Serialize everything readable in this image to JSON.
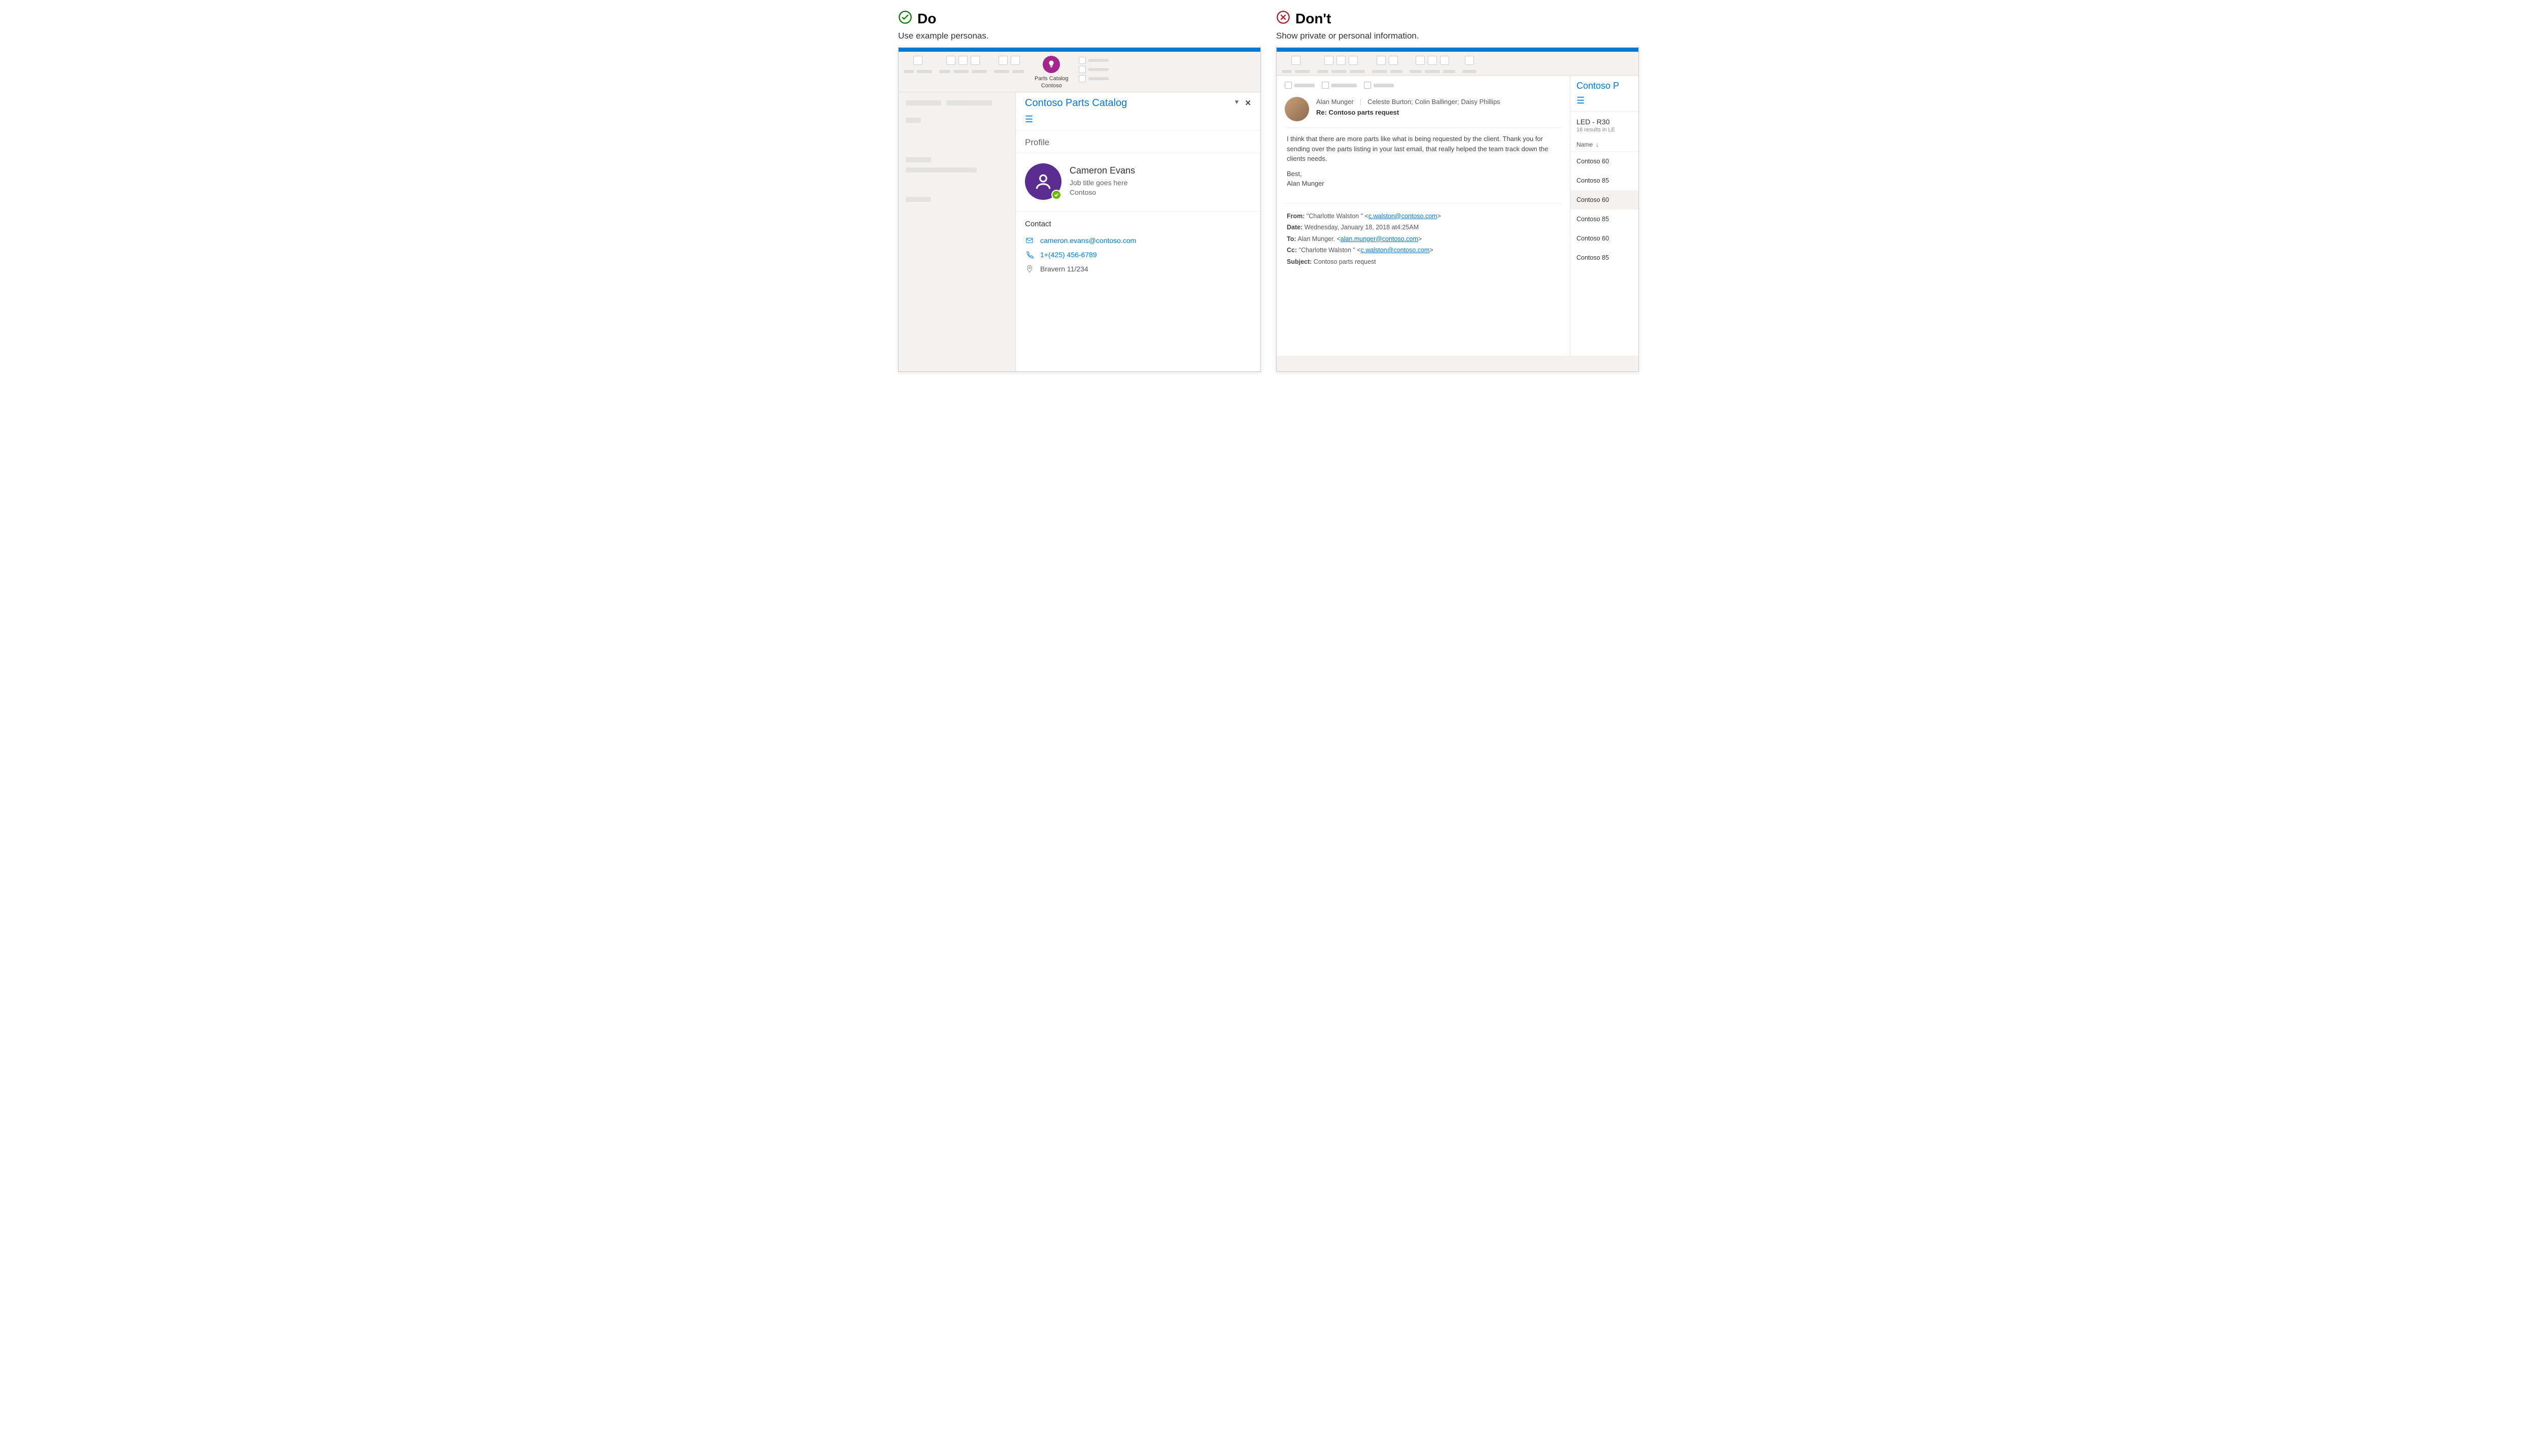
{
  "do": {
    "title": "Do",
    "subtitle": "Use example personas.",
    "addin": {
      "name": "Parts Catalog",
      "publisher": "Contoso"
    },
    "taskpane": {
      "title": "Contoso Parts Catalog",
      "profile_heading": "Profile",
      "persona": {
        "name": "Cameron Evans",
        "jobtitle": "Job title goes here",
        "company": "Contoso"
      },
      "contact": {
        "heading": "Contact",
        "email": "cameron.evans@contoso.com",
        "phone": "1+(425) 456-6789",
        "location": "Bravern 11/234"
      }
    }
  },
  "dont": {
    "title": "Don't",
    "subtitle": "Show private or personal information.",
    "mail": {
      "from": "Alan Munger",
      "recipients": "Celeste Burton; Colin Ballinger; Daisy Phillips",
      "subject": "Re: Contoso parts request",
      "body_p1": "I think that there are more parts like what is being requested by the client. Thank you for sending over the parts listing in your last email, that really helped the team track down the clients needs.",
      "body_signoff": "Best,",
      "body_name": "Alan Munger",
      "meta": {
        "from_label": "From:",
        "from_value_name": "\"Charlotte Walston \" <",
        "from_value_email": "c.walston@contoso.com",
        "from_value_tail": ">",
        "date_label": "Date:",
        "date_value": "Wednesday, January 18, 2018 at4:25AM",
        "to_label": "To:",
        "to_value_name": "Alan Munger. <",
        "to_value_email": "alan.munger@contoso.com",
        "to_value_tail": ">",
        "cc_label": "Cc:",
        "cc_value_name": "\"Charlotte Walston \" <",
        "cc_value_email": "c.walston@contoso.com",
        "cc_value_tail": ">",
        "subject_label": "Subject:",
        "subject_value": "Contoso parts request"
      }
    },
    "sidepane": {
      "title": "Contoso P",
      "heading": "LED - R30",
      "subcount": "16 results in LE",
      "col_name": "Name",
      "rows": [
        "Contoso 60",
        "Contoso 85",
        "Contoso 60",
        "Contoso 85",
        "Contoso 60",
        "Contoso 85"
      ]
    }
  }
}
